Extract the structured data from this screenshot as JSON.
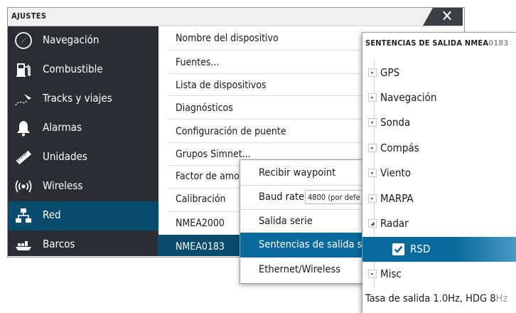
{
  "window": {
    "title": "AJUSTES",
    "close_glyph": "✕"
  },
  "sidebar": {
    "items": [
      {
        "label": "Navegación",
        "icon": "compass-icon"
      },
      {
        "label": "Combustible",
        "icon": "fuel-pump-icon"
      },
      {
        "label": "Tracks y viajes",
        "icon": "track-icon"
      },
      {
        "label": "Alarmas",
        "icon": "bell-icon"
      },
      {
        "label": "Unidades",
        "icon": "ruler-icon"
      },
      {
        "label": "Wireless",
        "icon": "wireless-icon"
      },
      {
        "label": "Red",
        "icon": "network-icon",
        "selected": true
      },
      {
        "label": "Barcos",
        "icon": "ships-icon"
      }
    ]
  },
  "network_menu": {
    "items": [
      "Nombre del dispositivo",
      "Fuentes...",
      "Lista de dispositivos",
      "Diagnósticos",
      "Configuración de puente",
      "Grupos Simnet...",
      "Factor de amor",
      "Calibración",
      "NMEA2000",
      "NMEA0183"
    ],
    "selected": "NMEA0183"
  },
  "nmea0183_menu": {
    "items": [
      {
        "label": "Recibir waypoint"
      },
      {
        "label": "Baud rate",
        "value": "4800 (por defe"
      },
      {
        "label": "Salida serie"
      },
      {
        "label": "Sentencias de salida se",
        "selected": true
      },
      {
        "label": "Ethernet/Wireless"
      }
    ]
  },
  "output_sentences": {
    "title_main": "SENTENCIAS DE SALIDA NMEA",
    "title_dim": "0183",
    "tree": [
      {
        "label": "GPS",
        "expanded": false
      },
      {
        "label": "Navegación",
        "expanded": false
      },
      {
        "label": "Sonda",
        "expanded": false
      },
      {
        "label": "Compás",
        "expanded": false
      },
      {
        "label": "Viento",
        "expanded": false
      },
      {
        "label": "MARPA",
        "expanded": false
      },
      {
        "label": "Radar",
        "expanded": true
      },
      {
        "label": "Misc",
        "expanded": false
      }
    ],
    "rsd": {
      "label": "RSD",
      "checked": true
    },
    "footer_main": "Tasa de salida 1.0Hz, HDG 8",
    "footer_dim": "Hz",
    "triangle_collapsed": "▸",
    "triangle_expanded": "◢",
    "checkmark": "✔"
  },
  "colors": {
    "sidebar_bg": "#2a2d31",
    "selected_dark": "#084b6d",
    "selected_accent": "#0a6a9c"
  }
}
